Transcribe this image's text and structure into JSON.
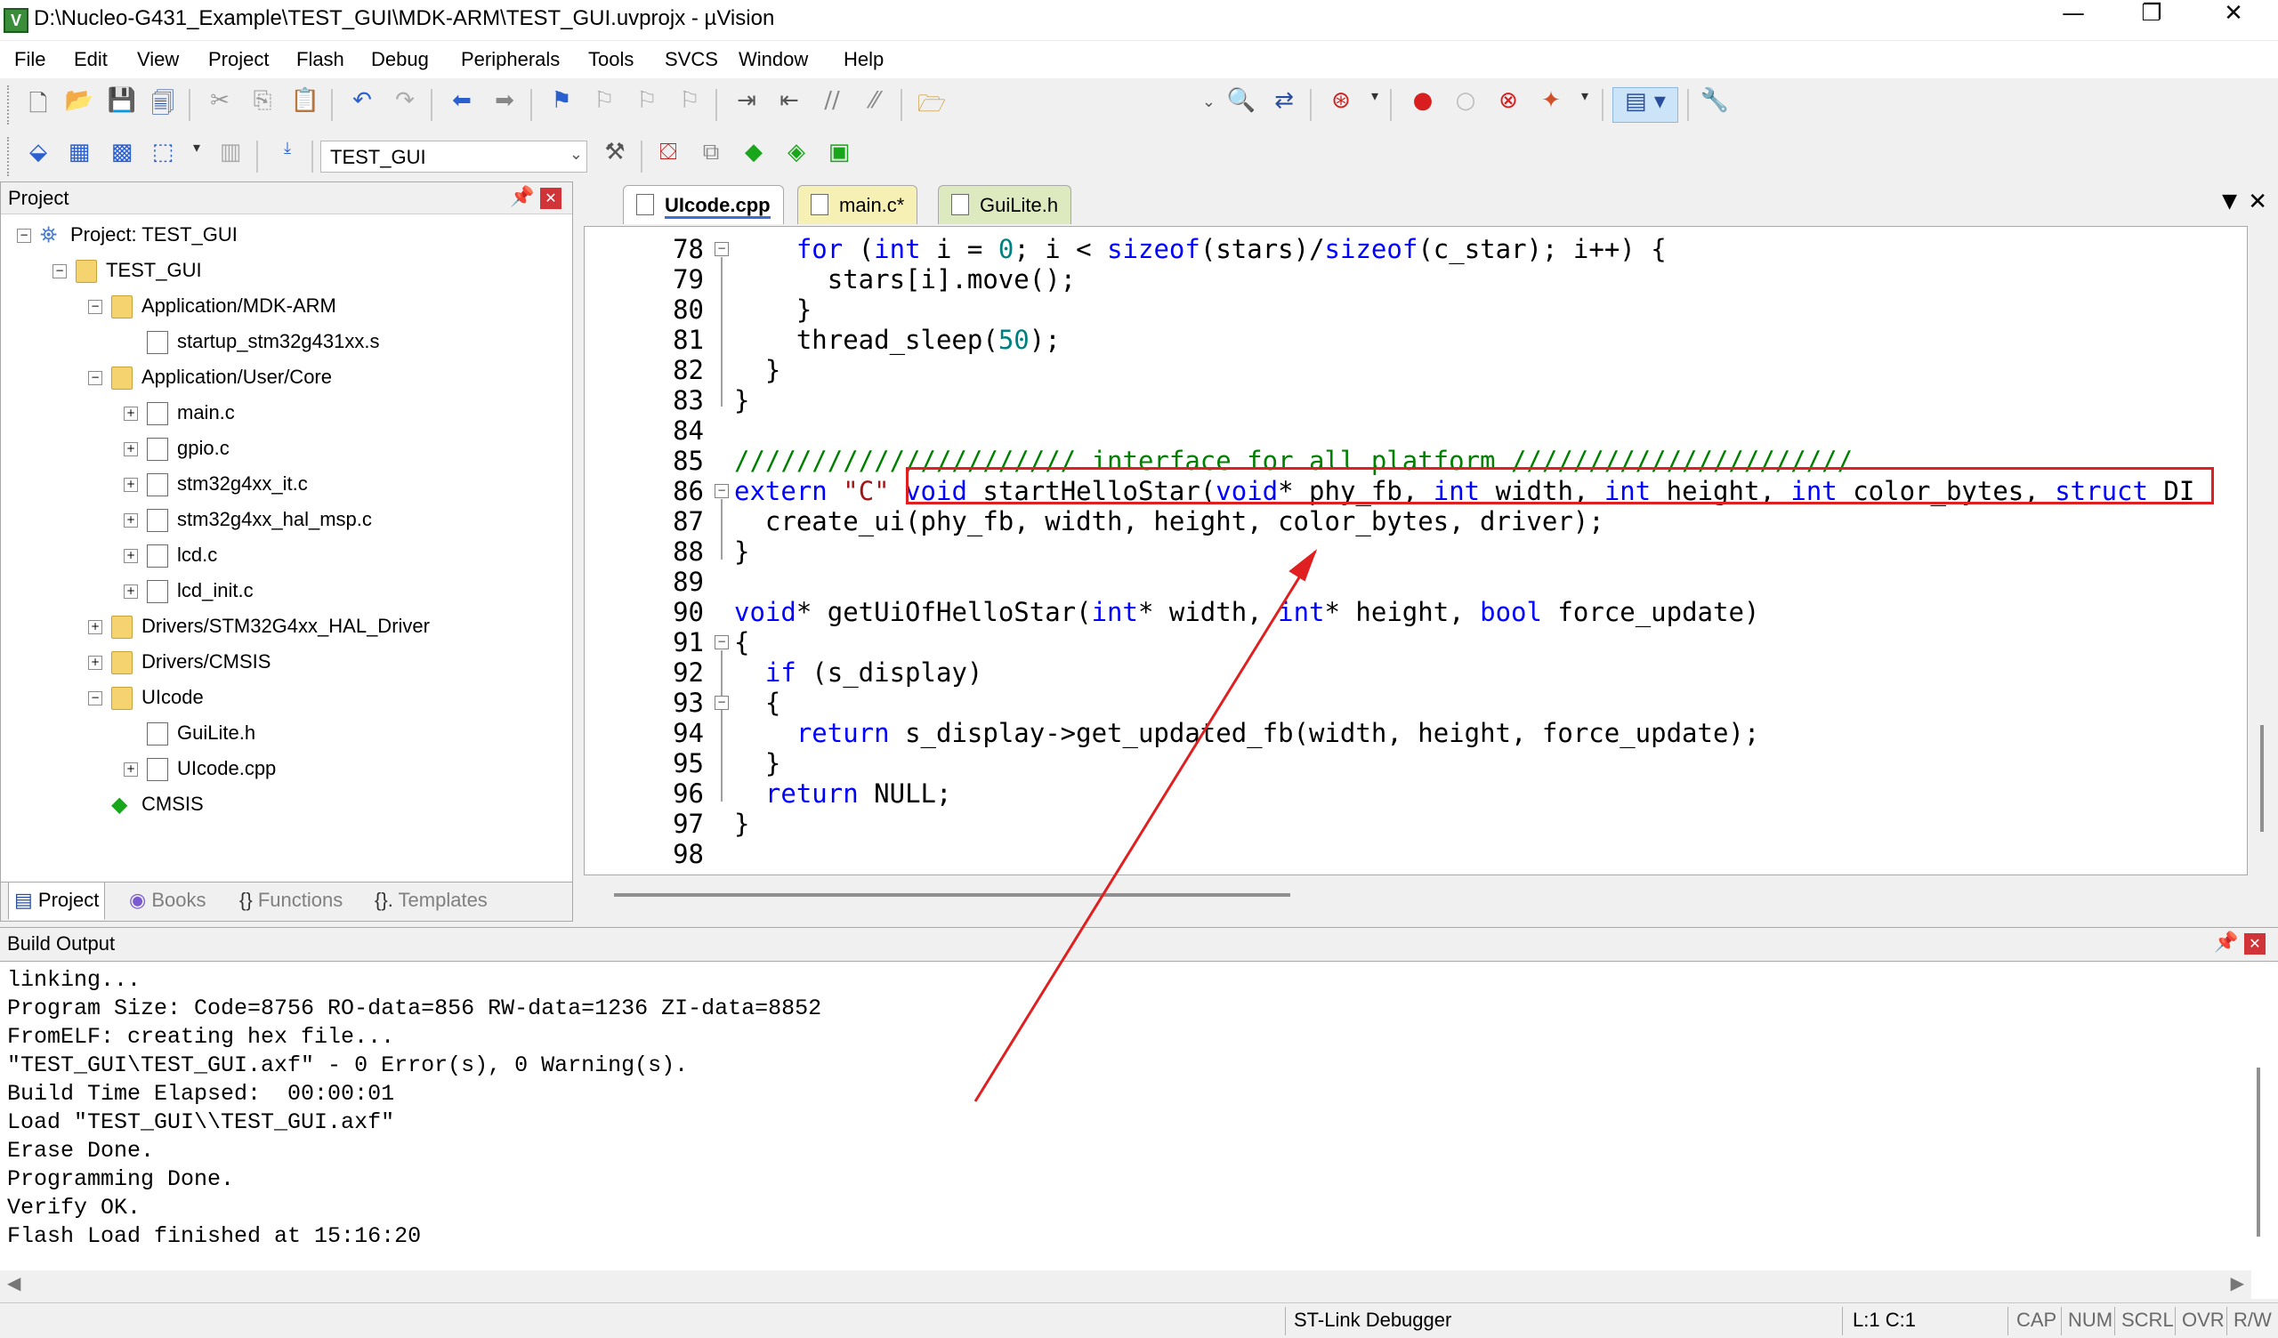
{
  "titlebar": {
    "title": "D:\\Nucleo-G431_Example\\TEST_GUI\\MDK-ARM\\TEST_GUI.uvprojx - µVision",
    "app_icon": "V",
    "minimize": "—",
    "maximize": "❐",
    "close": "✕"
  },
  "menu": [
    "File",
    "Edit",
    "View",
    "Project",
    "Flash",
    "Debug",
    "Peripherals",
    "Tools",
    "SVCS",
    "Window",
    "Help"
  ],
  "toolbar": {
    "target": "TEST_GUI",
    "icons": [
      "new-file-icon",
      "open-file-icon",
      "save-icon",
      "save-all-icon",
      "cut-icon",
      "copy-icon",
      "paste-icon",
      "undo-icon",
      "redo-icon",
      "nav-back-icon",
      "nav-forward-icon",
      "bookmark-icon",
      "bookmark-prev-icon",
      "bookmark-next-icon",
      "bookmark-clear-icon",
      "indent-icon",
      "unindent-icon",
      "comment-icon",
      "uncomment-icon",
      "find-in-files-icon",
      "find-icon",
      "replace-icon",
      "debug-start-icon",
      "breakpoint-icon",
      "breakpoint-disable-icon",
      "breakpoint-kill-icon",
      "watch-icon",
      "window-layout-icon",
      "configure-icon"
    ]
  },
  "project_panel": {
    "title": "Project",
    "tree": [
      {
        "label": "Project: TEST_GUI",
        "icon": "project-icon"
      },
      {
        "label": "TEST_GUI",
        "icon": "target-icon"
      },
      {
        "label": "Application/MDK-ARM",
        "icon": "folder-icon"
      },
      {
        "label": "startup_stm32g431xx.s",
        "icon": "file-icon"
      },
      {
        "label": "Application/User/Core",
        "icon": "folder-icon"
      },
      {
        "label": "main.c",
        "icon": "file-icon"
      },
      {
        "label": "gpio.c",
        "icon": "file-icon"
      },
      {
        "label": "stm32g4xx_it.c",
        "icon": "file-icon"
      },
      {
        "label": "stm32g4xx_hal_msp.c",
        "icon": "file-icon"
      },
      {
        "label": "lcd.c",
        "icon": "file-icon"
      },
      {
        "label": "lcd_init.c",
        "icon": "file-icon"
      },
      {
        "label": "Drivers/STM32G4xx_HAL_Driver",
        "icon": "folder-icon"
      },
      {
        "label": "Drivers/CMSIS",
        "icon": "folder-icon"
      },
      {
        "label": "UIcode",
        "icon": "folder-icon"
      },
      {
        "label": "GuiLite.h",
        "icon": "file-icon"
      },
      {
        "label": "UIcode.cpp",
        "icon": "file-icon"
      },
      {
        "label": "CMSIS",
        "icon": "cmsis-icon"
      }
    ],
    "tabs": [
      "Project",
      "Books",
      "Functions",
      "Templates"
    ]
  },
  "editor": {
    "tabs": [
      "UIcode.cpp",
      "main.c*",
      "GuiLite.h"
    ],
    "line_numbers": [
      "78",
      "79",
      "80",
      "81",
      "82",
      "83",
      "84",
      "85",
      "86",
      "87",
      "88",
      "89",
      "90",
      "91",
      "92",
      "93",
      "94",
      "95",
      "96",
      "97",
      "98"
    ]
  },
  "build_output": {
    "title": "Build Output",
    "lines": [
      "linking...",
      "Program Size: Code=8756 RO-data=856 RW-data=1236 ZI-data=8852",
      "FromELF: creating hex file...",
      "\"TEST_GUI\\TEST_GUI.axf\" - 0 Error(s), 0 Warning(s).",
      "Build Time Elapsed:  00:00:01",
      "Load \"TEST_GUI\\\\TEST_GUI.axf\"",
      "Erase Done.",
      "Programming Done.",
      "Verify OK.",
      "Flash Load finished at 15:16:20"
    ]
  },
  "statusbar": {
    "debugger": "ST-Link Debugger",
    "position": "L:1 C:1",
    "cap": "CAP",
    "num": "NUM",
    "scrl": "SCRL",
    "ovr": "OVR",
    "rw": "R/W"
  },
  "colors": {
    "keyword": "#0000ff",
    "string": "#a31515",
    "number": "#008080",
    "comment": "#008000",
    "highlight_box": "#e02020",
    "annotation_arrow": "#e02020"
  }
}
